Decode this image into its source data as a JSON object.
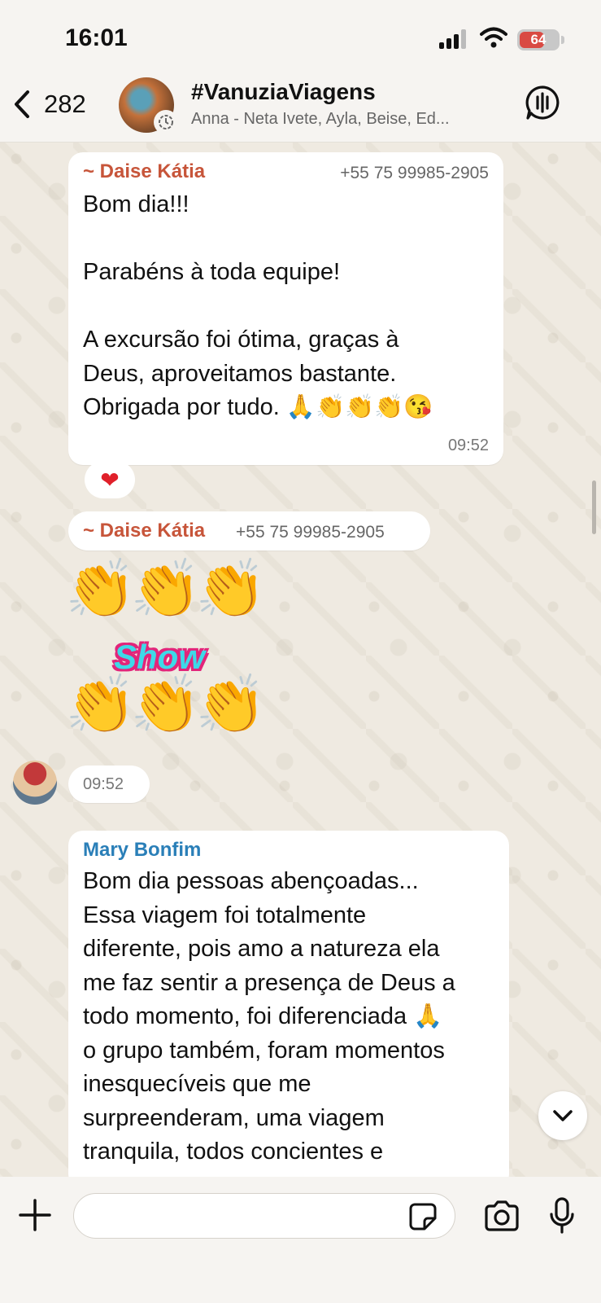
{
  "status_bar": {
    "time": "16:01",
    "battery": "64"
  },
  "header": {
    "back_count": "282",
    "title": "#VanuziaViagens",
    "subtitle": "Anna - Neta Ivete, Ayla, Beise, Ed..."
  },
  "messages": [
    {
      "sender": "~ Daise Kátia",
      "phone": "+55 75 99985-2905",
      "text": "Bom dia!!!\n\nParabéns à toda equipe!\n\nA excursão foi ótima, graças à\nDeus, aproveitamos bastante.\nObrigada por tudo. 🙏👏👏👏😘",
      "time": "09:52",
      "reaction": "❤"
    },
    {
      "sender": "~ Daise Kátia",
      "phone": "+55 75 99985-2905",
      "sticker_text": "Show",
      "sticker_emoji": "👏",
      "time": "09:52"
    },
    {
      "sender": "Mary Bonfim",
      "text": "Bom dia pessoas abençoadas...\nEssa viagem foi totalmente\ndiferente, pois amo a natureza ela\nme faz sentir a presença de Deus a\ntodo momento, foi diferenciada 🙏\no grupo também, foram momentos\ninesquecíveis que me\nsurpreenderam, uma viagem\ntranquila, todos concientes e"
    }
  ],
  "colors": {
    "sender_orange": "#c7553a",
    "sender_blue": "#2a7fb8",
    "bubble": "#ffffff",
    "wallpaper": "#efeae1"
  },
  "icons": {
    "back": "chevron-left-icon",
    "voice_chat": "voice-chat-icon",
    "plus": "plus-icon",
    "sticker": "sticker-icon",
    "camera": "camera-icon",
    "mic": "microphone-icon",
    "scroll_down": "chevron-down-icon"
  }
}
